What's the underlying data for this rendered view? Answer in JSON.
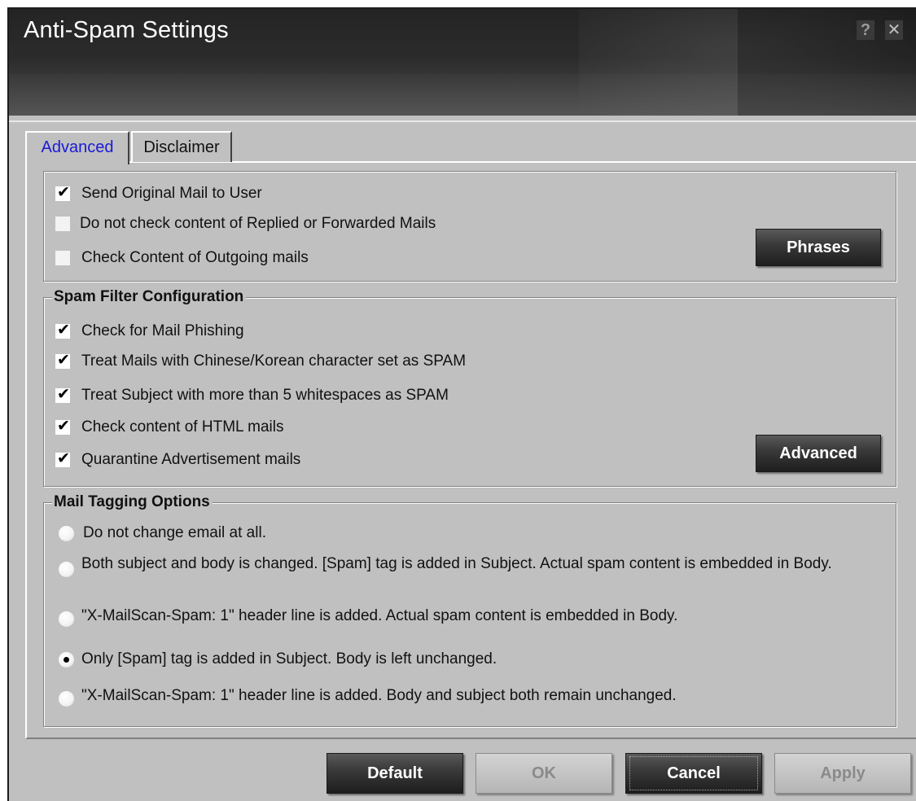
{
  "window": {
    "title": "Anti-Spam Settings",
    "help_glyph": "?",
    "close_glyph": "✕"
  },
  "tabs": [
    {
      "label": "Advanced",
      "active": true
    },
    {
      "label": "Disclaimer",
      "active": false
    }
  ],
  "general": {
    "options": [
      {
        "label": "Send Original Mail to User",
        "checked": true
      },
      {
        "label": "Do not check content of Replied or Forwarded Mails",
        "checked": false
      },
      {
        "label": "Check Content of Outgoing mails",
        "checked": false
      }
    ],
    "phrases_button": "Phrases"
  },
  "spam_filter": {
    "title": "Spam Filter Configuration",
    "options": [
      {
        "label": "Check for Mail Phishing",
        "checked": true
      },
      {
        "label": "Treat Mails with Chinese/Korean character set as SPAM",
        "checked": true
      },
      {
        "label": "Treat Subject with more than 5 whitespaces as SPAM",
        "checked": true
      },
      {
        "label": "Check content of HTML mails",
        "checked": true
      },
      {
        "label": "Quarantine Advertisement mails",
        "checked": true
      }
    ],
    "advanced_button": "Advanced"
  },
  "mail_tagging": {
    "title": "Mail Tagging Options",
    "options": [
      {
        "label": "Do not change email at all.",
        "selected": false
      },
      {
        "label": "Both subject and body is changed.  [Spam] tag is added in Subject. Actual spam content is embedded in Body.",
        "selected": false
      },
      {
        "label": "\"X-MailScan-Spam: 1\" header line is added.  Actual spam content is embedded in Body.",
        "selected": false
      },
      {
        "label": "Only [Spam] tag is added in Subject. Body is left unchanged.",
        "selected": true
      },
      {
        "label": "\"X-MailScan-Spam: 1\" header line is added.  Body and subject both remain unchanged.",
        "selected": false
      }
    ]
  },
  "footer": {
    "default_button": "Default",
    "ok_button": "OK",
    "cancel_button": "Cancel",
    "apply_button": "Apply"
  },
  "check_glyph": "✔"
}
